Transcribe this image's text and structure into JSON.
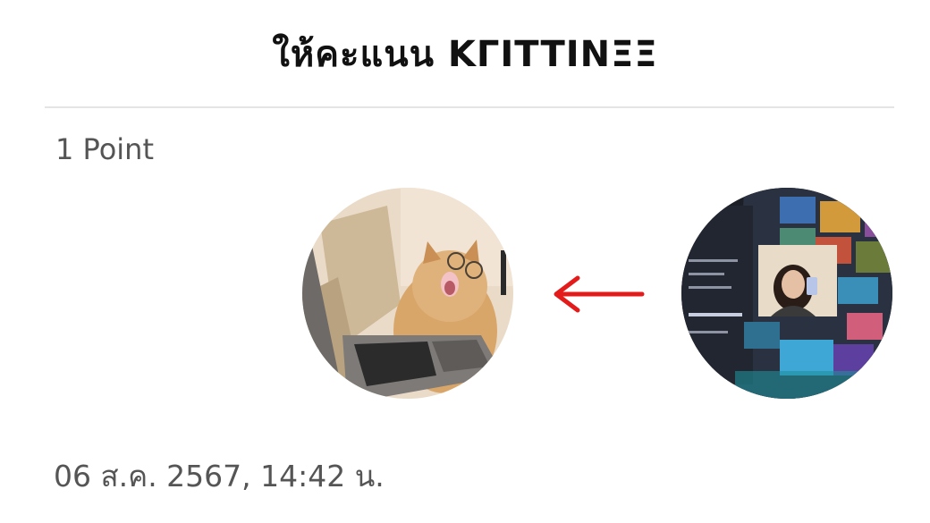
{
  "header": {
    "title": "ให้คะแนน KΓITTINΞΞ"
  },
  "rating": {
    "points_label": "1 Point"
  },
  "transfer": {
    "direction_icon": "arrow-left-icon",
    "arrow_color": "#e31b1b",
    "receiver_avatar": "cat-with-glasses-photo",
    "giver_avatar": "girl-selfie-with-monitor-photo"
  },
  "footer": {
    "timestamp": "06 ส.ค. 2567, 14:42 น."
  }
}
